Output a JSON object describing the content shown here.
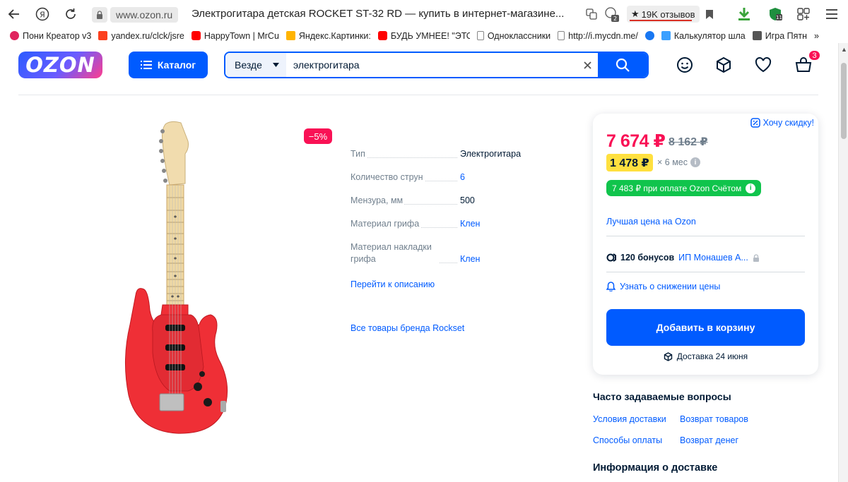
{
  "browser": {
    "url_domain": "www.ozon.ru",
    "tab_title": "Электрогитара детская ROCKET ST-32 RD — купить в интернет-магазине...",
    "reviews_badge": "19K отзывов",
    "extension_count": "2",
    "bookmarks": [
      {
        "label": "Пони Креатор v3",
        "icon": "heart-icon",
        "color": "#e0245e"
      },
      {
        "label": "yandex.ru/clck/jsre",
        "icon": "yandex-icon",
        "color": "#fc3f1d"
      },
      {
        "label": "HappyTown | MrCu",
        "icon": "youtube-icon",
        "color": "#ff0000"
      },
      {
        "label": "Яндекс.Картинки:",
        "icon": "images-icon",
        "color": "#ffb400"
      },
      {
        "label": "БУДЬ УМНЕЕ! \"ЭТО",
        "icon": "youtube-icon",
        "color": "#ff0000"
      },
      {
        "label": "Одноклассники",
        "icon": "page-icon",
        "color": "#888888"
      },
      {
        "label": "http://i.mycdn.me/",
        "icon": "page-icon",
        "color": "#888888"
      },
      {
        "label": "",
        "icon": "facebook-icon",
        "color": "#1877f2"
      },
      {
        "label": "Калькулятор шла",
        "icon": "calculator-icon",
        "color": "#3ba0ff"
      },
      {
        "label": "Игра Пятн",
        "icon": "game-icon",
        "color": "#555555"
      }
    ],
    "bookmarks_overflow": "»"
  },
  "header": {
    "logo": "OZON",
    "catalog_label": "Каталог",
    "search_scope": "Везде",
    "search_value": "электрогитара",
    "cart_count": "3"
  },
  "product": {
    "discount_badge": "−5%",
    "specs": [
      {
        "name": "Тип",
        "value": "Электрогитара",
        "is_link": false
      },
      {
        "name": "Количество струн",
        "value": "6",
        "is_link": true
      },
      {
        "name": "Мензура, мм",
        "value": "500",
        "is_link": false
      },
      {
        "name": "Материал грифа",
        "value": "Клен",
        "is_link": true
      },
      {
        "name": "Материал накладки грифа",
        "value": "Клен",
        "is_link": true
      }
    ],
    "goto_description": "Перейти к описанию",
    "brand_link": "Все товары бренда Rockset"
  },
  "price_card": {
    "want_discount": "Хочу скидку!",
    "price_now": "7 674 ₽",
    "price_old": "8 162 ₽",
    "installment": "1 478 ₽",
    "installment_mult": "× 6 мес",
    "ozon_account": "7 483 ₽ при оплате Ozon Счётом",
    "best_price": "Лучшая цена на Ozon",
    "bonus": "120 бонусов",
    "seller": "ИП Монашев А...",
    "price_drop": "Узнать о снижении цены",
    "add_to_cart": "Добавить в корзину",
    "delivery": "Доставка 24 июня"
  },
  "faq": {
    "title": "Часто задаваемые вопросы",
    "links": [
      "Условия доставки",
      "Возврат товаров",
      "Способы оплаты",
      "Возврат денег"
    ],
    "delivery_info": "Информация о доставке"
  },
  "colors": {
    "brand_blue": "#005bff",
    "sale_pink": "#f91155",
    "installment_yellow": "#ffe03f",
    "ozon_account_green": "#10c44c"
  }
}
